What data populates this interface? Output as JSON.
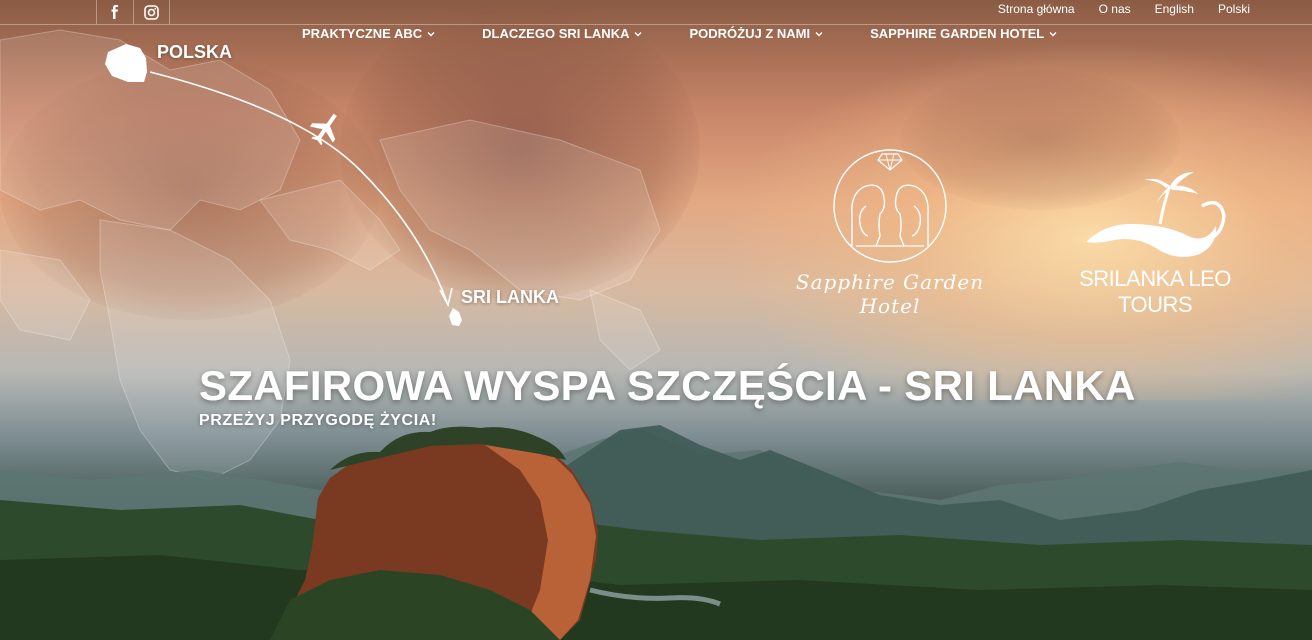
{
  "social": {
    "facebook_icon": "facebook-icon",
    "instagram_icon": "instagram-icon"
  },
  "top_links": [
    "Strona główna",
    "O nas",
    "English",
    "Polski"
  ],
  "main_nav": [
    {
      "label": "PRAKTYCZNE ABC"
    },
    {
      "label": "DLACZEGO SRI LANKA"
    },
    {
      "label": "PODRÓŻUJ Z NAMI"
    },
    {
      "label": "SAPPHIRE GARDEN HOTEL"
    }
  ],
  "map": {
    "origin_label": "POLSKA",
    "destination_label": "SRI LANKA",
    "plane_icon": "airplane-icon"
  },
  "logos": {
    "hotel_name": "Sapphire Garden Hotel",
    "tours_name": "SRILANKA LEO TOURS"
  },
  "hero": {
    "title": "SZAFIROWA WYSPA SZCZĘŚCIA - SRI LANKA",
    "subtitle": "PRZEŻYJ PRZYGODĘ ŻYCIA!"
  },
  "colors": {
    "text": "#ffffff",
    "sky_warm": "#e3a984",
    "rock": "#7a3a22",
    "jungle": "#2f4a2c"
  }
}
